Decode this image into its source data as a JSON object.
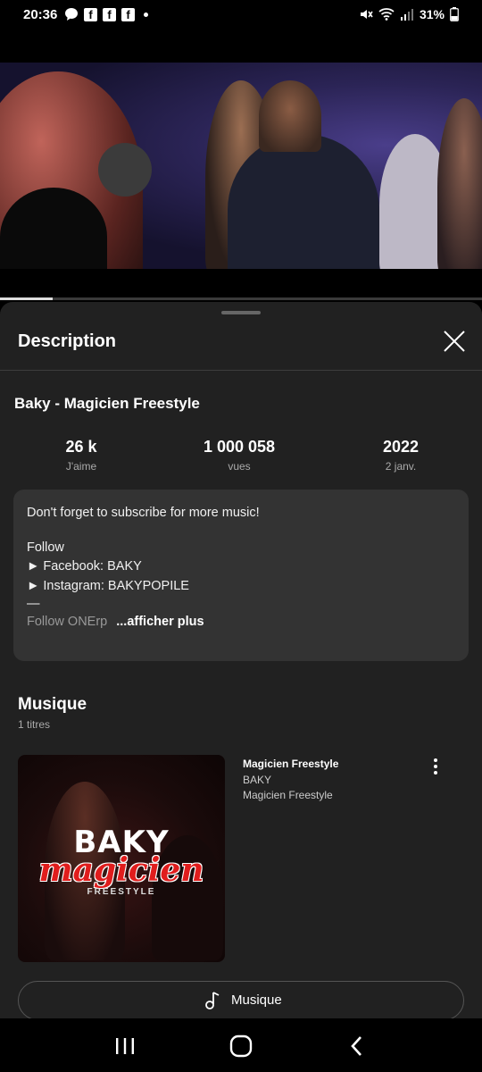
{
  "status_bar": {
    "time": "20:36",
    "battery": "31%"
  },
  "video": {
    "progress": 0.11
  },
  "panel": {
    "title": "Description",
    "video_title": "Baky - Magicien Freestyle",
    "stats": [
      {
        "value": "26 k",
        "label": "J'aime"
      },
      {
        "value": "1 000 058",
        "label": "vues"
      },
      {
        "value": "2022",
        "label": "2 janv."
      }
    ],
    "description": {
      "line1": "Don't forget to subscribe for more music!",
      "line2": "Follow",
      "line3": "► Facebook: BAKY",
      "line4": "► Instagram: BAKYPOPILE",
      "line5": "—",
      "line6": "Follow ONErp",
      "more": "...afficher plus"
    }
  },
  "music": {
    "heading": "Musique",
    "count": "1 titres",
    "track": {
      "title": "Magicien Freestyle",
      "artist": "BAKY",
      "album": "Magicien Freestyle"
    },
    "cover": {
      "artist": "BAKY",
      "title": "magicien",
      "subtitle": "FREESTYLE"
    },
    "button_label": "Musique"
  },
  "icons": {
    "messenger": "chat-bubble-icon",
    "facebook": "facebook-icon",
    "mute": "mute-icon",
    "wifi": "wifi-icon",
    "signal": "signal-icon",
    "battery": "battery-icon",
    "close": "close-icon",
    "more": "more-vert-icon",
    "music": "music-note-icon",
    "recents": "recents-icon",
    "home": "home-icon",
    "back": "back-icon"
  }
}
